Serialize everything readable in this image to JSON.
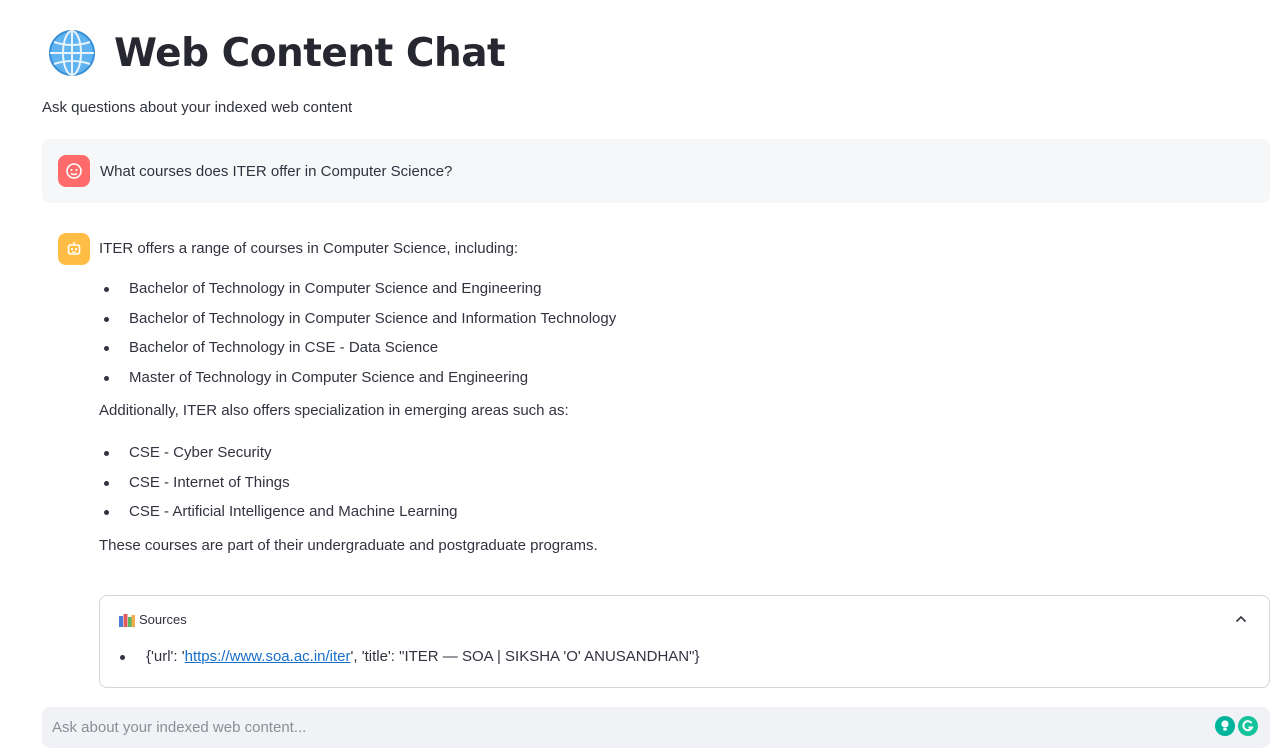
{
  "header": {
    "icon": "globe-icon",
    "title": "Web Content Chat",
    "subtitle": "Ask questions about your indexed web content"
  },
  "messages": {
    "user": {
      "avatar_icon": "user-face-icon",
      "text": "What courses does ITER offer in Computer Science?"
    },
    "assistant": {
      "avatar_icon": "robot-icon",
      "intro": "ITER offers a range of courses in Computer Science, including:",
      "courses": [
        "Bachelor of Technology in Computer Science and Engineering",
        "Bachelor of Technology in Computer Science and Information Technology",
        "Bachelor of Technology in CSE - Data Science",
        "Master of Technology in Computer Science and Engineering"
      ],
      "additional": "Additionally, ITER also offers specialization in emerging areas such as:",
      "specializations": [
        "CSE - Cyber Security",
        "CSE - Internet of Things",
        "CSE - Artificial Intelligence and Machine Learning"
      ],
      "closing": "These courses are part of their undergraduate and postgraduate programs."
    }
  },
  "sources": {
    "label": "Sources",
    "icon": "books-icon",
    "item_prefix": "{'url': '",
    "item_url": "https://www.soa.ac.in/iter",
    "item_suffix": "', 'title': \"ITER — SOA | SIKSHA 'O' ANUSANDHAN\"}"
  },
  "chat_input": {
    "placeholder": "Ask about your indexed web content...",
    "value": ""
  },
  "colors": {
    "user_avatar": "#ff6b6b",
    "bot_avatar": "#ffbd45",
    "link": "#1a6ec9",
    "input_bg": "#f0f2f6"
  }
}
